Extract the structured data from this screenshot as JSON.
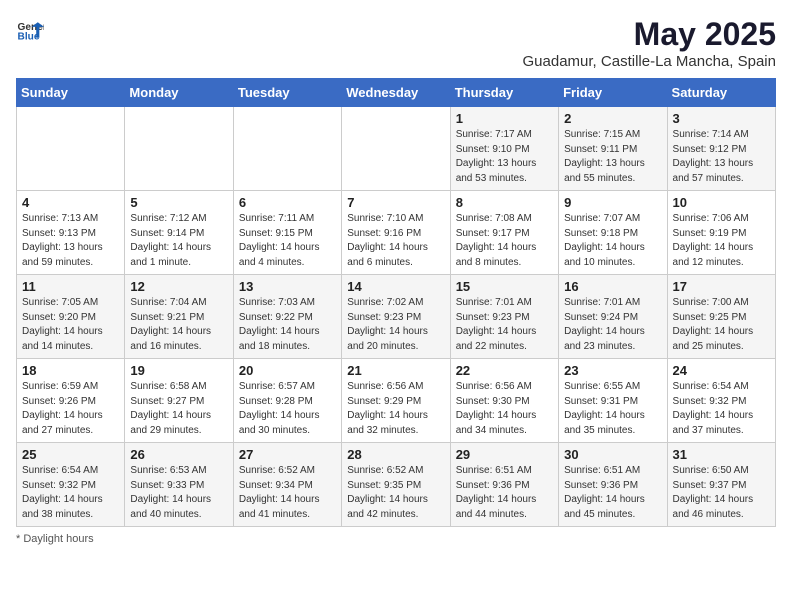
{
  "header": {
    "logo_general": "General",
    "logo_blue": "Blue",
    "title": "May 2025",
    "subtitle": "Guadamur, Castille-La Mancha, Spain"
  },
  "days_of_week": [
    "Sunday",
    "Monday",
    "Tuesday",
    "Wednesday",
    "Thursday",
    "Friday",
    "Saturday"
  ],
  "weeks": [
    [
      {
        "day": "",
        "info": ""
      },
      {
        "day": "",
        "info": ""
      },
      {
        "day": "",
        "info": ""
      },
      {
        "day": "",
        "info": ""
      },
      {
        "day": "1",
        "info": "Sunrise: 7:17 AM\nSunset: 9:10 PM\nDaylight: 13 hours\nand 53 minutes."
      },
      {
        "day": "2",
        "info": "Sunrise: 7:15 AM\nSunset: 9:11 PM\nDaylight: 13 hours\nand 55 minutes."
      },
      {
        "day": "3",
        "info": "Sunrise: 7:14 AM\nSunset: 9:12 PM\nDaylight: 13 hours\nand 57 minutes."
      }
    ],
    [
      {
        "day": "4",
        "info": "Sunrise: 7:13 AM\nSunset: 9:13 PM\nDaylight: 13 hours\nand 59 minutes."
      },
      {
        "day": "5",
        "info": "Sunrise: 7:12 AM\nSunset: 9:14 PM\nDaylight: 14 hours\nand 1 minute."
      },
      {
        "day": "6",
        "info": "Sunrise: 7:11 AM\nSunset: 9:15 PM\nDaylight: 14 hours\nand 4 minutes."
      },
      {
        "day": "7",
        "info": "Sunrise: 7:10 AM\nSunset: 9:16 PM\nDaylight: 14 hours\nand 6 minutes."
      },
      {
        "day": "8",
        "info": "Sunrise: 7:08 AM\nSunset: 9:17 PM\nDaylight: 14 hours\nand 8 minutes."
      },
      {
        "day": "9",
        "info": "Sunrise: 7:07 AM\nSunset: 9:18 PM\nDaylight: 14 hours\nand 10 minutes."
      },
      {
        "day": "10",
        "info": "Sunrise: 7:06 AM\nSunset: 9:19 PM\nDaylight: 14 hours\nand 12 minutes."
      }
    ],
    [
      {
        "day": "11",
        "info": "Sunrise: 7:05 AM\nSunset: 9:20 PM\nDaylight: 14 hours\nand 14 minutes."
      },
      {
        "day": "12",
        "info": "Sunrise: 7:04 AM\nSunset: 9:21 PM\nDaylight: 14 hours\nand 16 minutes."
      },
      {
        "day": "13",
        "info": "Sunrise: 7:03 AM\nSunset: 9:22 PM\nDaylight: 14 hours\nand 18 minutes."
      },
      {
        "day": "14",
        "info": "Sunrise: 7:02 AM\nSunset: 9:23 PM\nDaylight: 14 hours\nand 20 minutes."
      },
      {
        "day": "15",
        "info": "Sunrise: 7:01 AM\nSunset: 9:23 PM\nDaylight: 14 hours\nand 22 minutes."
      },
      {
        "day": "16",
        "info": "Sunrise: 7:01 AM\nSunset: 9:24 PM\nDaylight: 14 hours\nand 23 minutes."
      },
      {
        "day": "17",
        "info": "Sunrise: 7:00 AM\nSunset: 9:25 PM\nDaylight: 14 hours\nand 25 minutes."
      }
    ],
    [
      {
        "day": "18",
        "info": "Sunrise: 6:59 AM\nSunset: 9:26 PM\nDaylight: 14 hours\nand 27 minutes."
      },
      {
        "day": "19",
        "info": "Sunrise: 6:58 AM\nSunset: 9:27 PM\nDaylight: 14 hours\nand 29 minutes."
      },
      {
        "day": "20",
        "info": "Sunrise: 6:57 AM\nSunset: 9:28 PM\nDaylight: 14 hours\nand 30 minutes."
      },
      {
        "day": "21",
        "info": "Sunrise: 6:56 AM\nSunset: 9:29 PM\nDaylight: 14 hours\nand 32 minutes."
      },
      {
        "day": "22",
        "info": "Sunrise: 6:56 AM\nSunset: 9:30 PM\nDaylight: 14 hours\nand 34 minutes."
      },
      {
        "day": "23",
        "info": "Sunrise: 6:55 AM\nSunset: 9:31 PM\nDaylight: 14 hours\nand 35 minutes."
      },
      {
        "day": "24",
        "info": "Sunrise: 6:54 AM\nSunset: 9:32 PM\nDaylight: 14 hours\nand 37 minutes."
      }
    ],
    [
      {
        "day": "25",
        "info": "Sunrise: 6:54 AM\nSunset: 9:32 PM\nDaylight: 14 hours\nand 38 minutes."
      },
      {
        "day": "26",
        "info": "Sunrise: 6:53 AM\nSunset: 9:33 PM\nDaylight: 14 hours\nand 40 minutes."
      },
      {
        "day": "27",
        "info": "Sunrise: 6:52 AM\nSunset: 9:34 PM\nDaylight: 14 hours\nand 41 minutes."
      },
      {
        "day": "28",
        "info": "Sunrise: 6:52 AM\nSunset: 9:35 PM\nDaylight: 14 hours\nand 42 minutes."
      },
      {
        "day": "29",
        "info": "Sunrise: 6:51 AM\nSunset: 9:36 PM\nDaylight: 14 hours\nand 44 minutes."
      },
      {
        "day": "30",
        "info": "Sunrise: 6:51 AM\nSunset: 9:36 PM\nDaylight: 14 hours\nand 45 minutes."
      },
      {
        "day": "31",
        "info": "Sunrise: 6:50 AM\nSunset: 9:37 PM\nDaylight: 14 hours\nand 46 minutes."
      }
    ]
  ],
  "footer": {
    "note": "Daylight hours"
  }
}
